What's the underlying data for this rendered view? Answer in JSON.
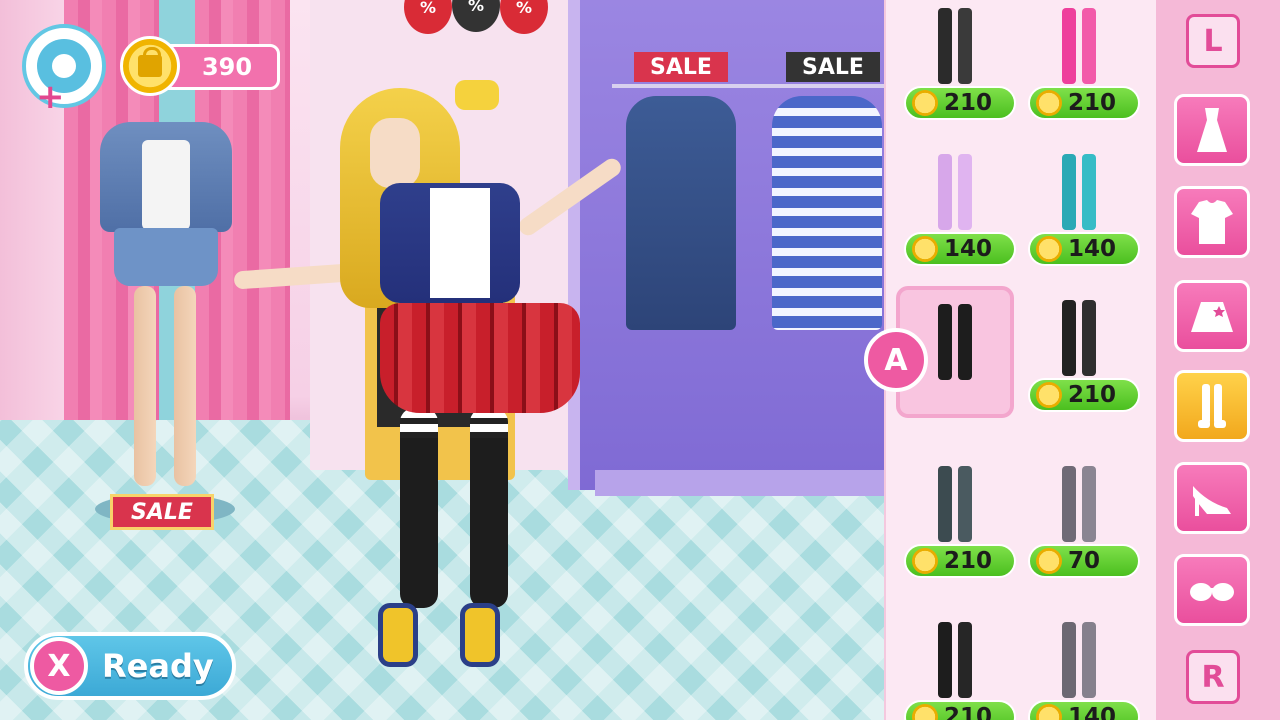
{
  "hud": {
    "coins": "390",
    "ready_key": "X",
    "ready_label": "Ready"
  },
  "scene": {
    "sale_tags": [
      "SALE",
      "SALE",
      "SALE"
    ],
    "balloon_text": "%"
  },
  "panel": {
    "selected_badge": "A",
    "items": [
      {
        "price": "210",
        "color_a": "#2b2b2b",
        "color_b": "#3a3a3a"
      },
      {
        "price": "210",
        "color_a": "#ee3f9c",
        "color_b": "#f25aa9"
      },
      {
        "price": "140",
        "color_a": "#d7a7ea",
        "color_b": "#e0b4f0"
      },
      {
        "price": "140",
        "color_a": "#2aa9b5",
        "color_b": "#36bcc6"
      },
      {
        "price": "",
        "color_a": "#1d1d1d",
        "color_b": "#1d1d1d",
        "selected": true
      },
      {
        "price": "210",
        "color_a": "#222222",
        "color_b": "#2f2f2f"
      },
      {
        "price": "210",
        "color_a": "#3c4b50",
        "color_b": "#4a5a60"
      },
      {
        "price": "70",
        "color_a": "#6f6a76",
        "color_b": "#8a8592"
      },
      {
        "price": "210",
        "color_a": "#1d1d1d",
        "color_b": "#262626"
      },
      {
        "price": "140",
        "color_a": "#6c6872",
        "color_b": "#85808c"
      }
    ]
  },
  "sidebar": {
    "left_button": "L",
    "right_button": "R",
    "categories": [
      {
        "icon": "dress-icon"
      },
      {
        "icon": "top-icon"
      },
      {
        "icon": "skirt-icon"
      },
      {
        "icon": "stockings-icon",
        "active": true
      },
      {
        "icon": "heels-icon"
      },
      {
        "icon": "sunglasses-icon"
      }
    ]
  }
}
